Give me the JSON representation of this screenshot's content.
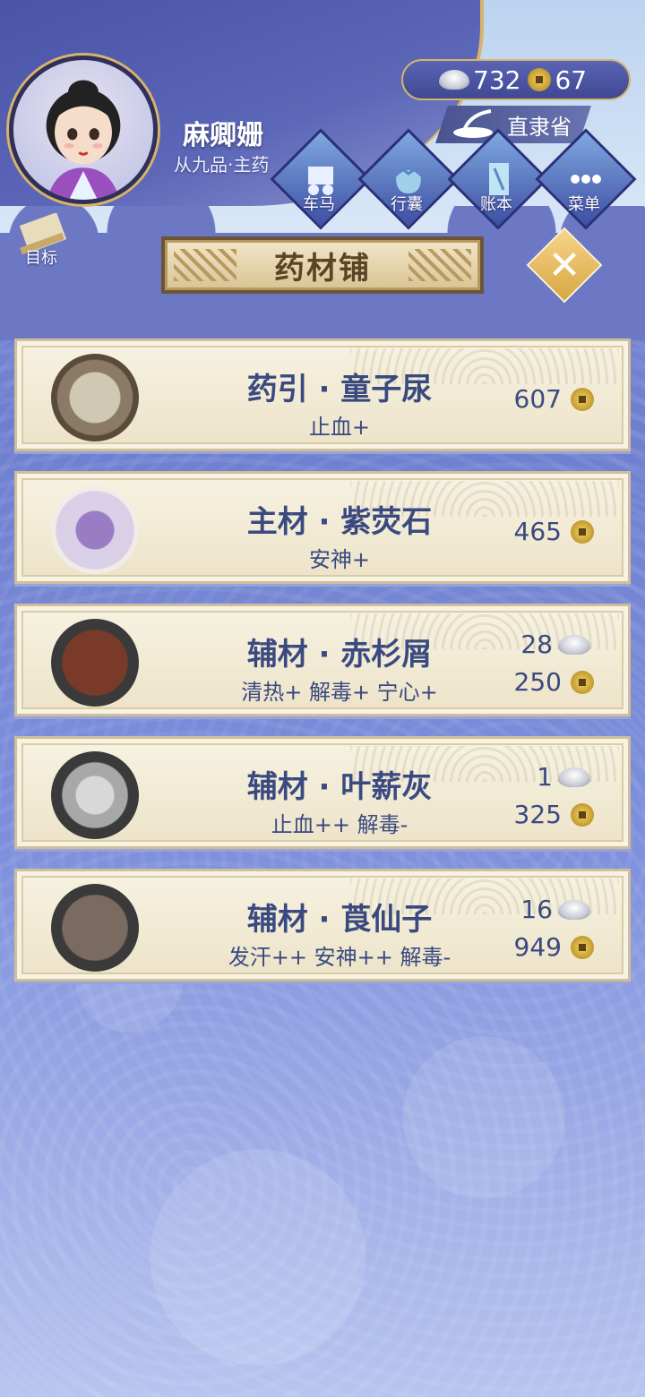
{
  "header": {
    "player_name": "麻卿姗",
    "player_rank": "从九品·主药",
    "silver": "732",
    "coins": "67",
    "region": "直隶省",
    "goal_label": "目标"
  },
  "nav": [
    {
      "label": "车马",
      "icon": "carriage-icon"
    },
    {
      "label": "行囊",
      "icon": "bundle-icon"
    },
    {
      "label": "账本",
      "icon": "ledger-icon"
    },
    {
      "label": "菜单",
      "icon": "menu-dots-icon"
    }
  ],
  "shop": {
    "title": "药材铺"
  },
  "items": [
    {
      "title": "药引 · 童子尿",
      "effect": "止血+",
      "silver": "",
      "coins": "607",
      "dish": "#8a7a66",
      "fill": "#cfc9b4"
    },
    {
      "title": "主材 · 紫荧石",
      "effect": "安神+",
      "silver": "",
      "coins": "465",
      "dish": "#f1ece8",
      "fill": "#9a7cc4"
    },
    {
      "title": "辅材 · 赤杉屑",
      "effect": "清热+ 解毒+ 宁心+",
      "silver": "28",
      "coins": "250",
      "dish": "#3a3a3a",
      "fill": "#7a3a2a"
    },
    {
      "title": "辅材 · 叶薪灰",
      "effect": "止血++ 解毒-",
      "silver": "1",
      "coins": "325",
      "dish": "#3a3a3a",
      "fill": "#c8c8c8"
    },
    {
      "title": "辅材 · 莨仙子",
      "effect": "发汗++ 安神++ 解毒-",
      "silver": "16",
      "coins": "949",
      "dish": "#3a3a3a",
      "fill": "#7a6a60"
    }
  ],
  "colors": {
    "accent_gold": "#d6b46a",
    "text_blue": "#3a4a80",
    "card_bg": "#f7f2e2"
  }
}
